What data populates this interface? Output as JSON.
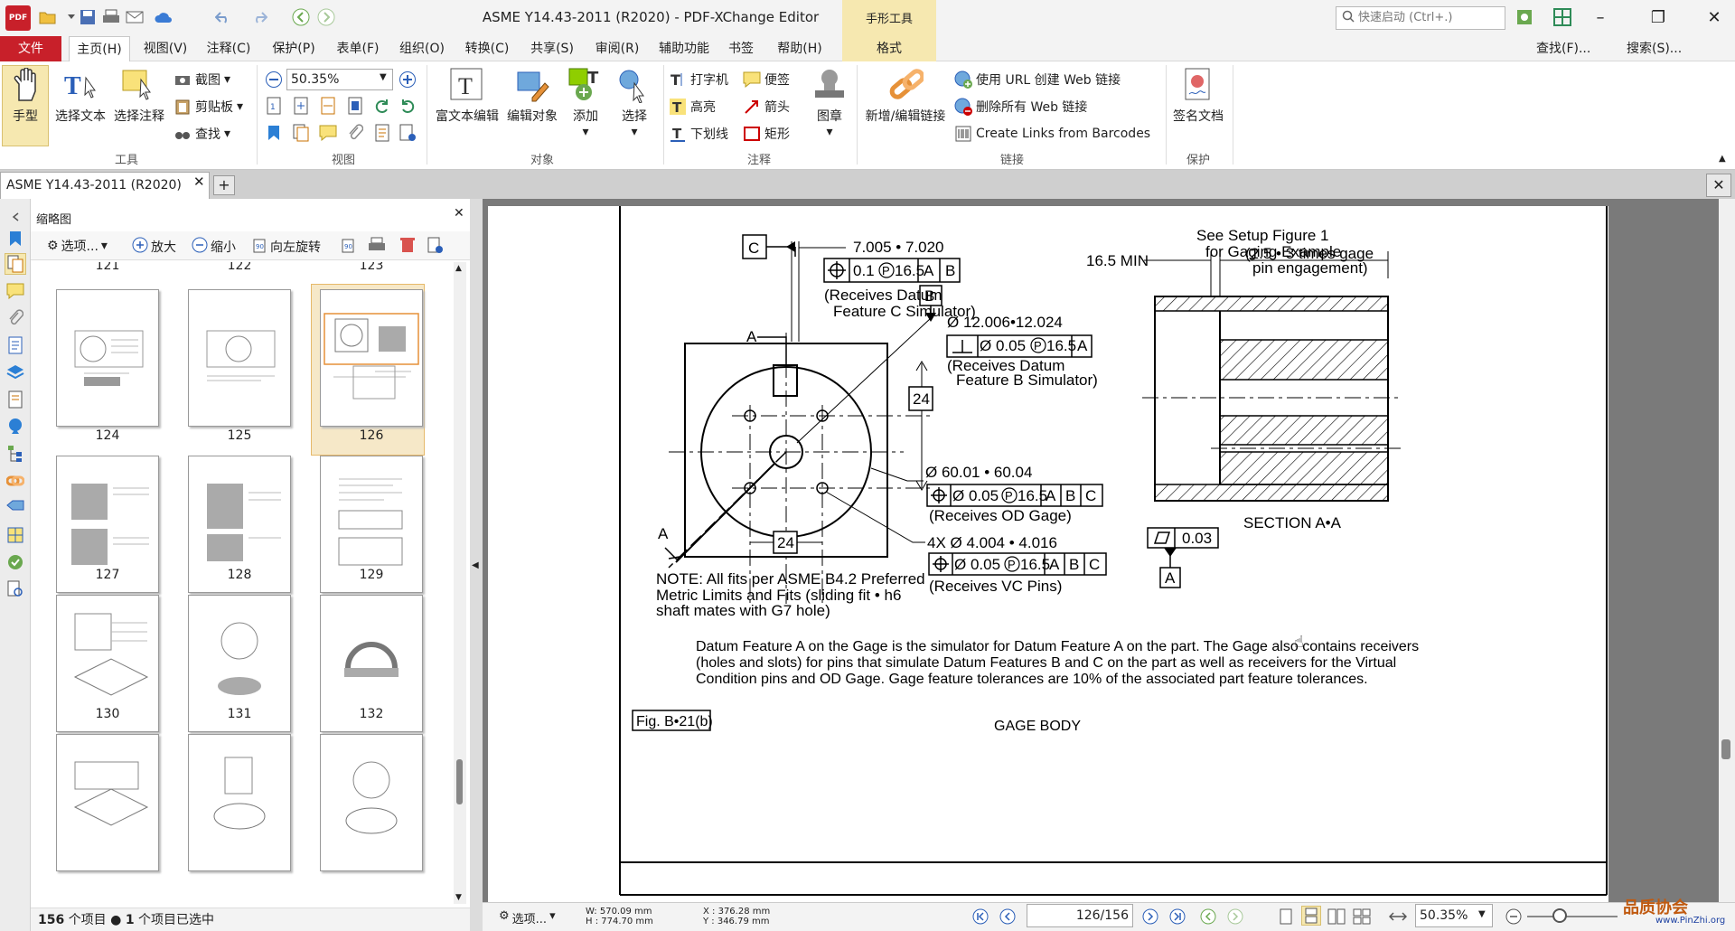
{
  "window": {
    "title": "ASME Y14.43-2011 (R2020) - PDF-XChange Editor",
    "context_tab_group": "手形工具",
    "quick_launch_placeholder": "快速启动 (Ctrl+.)",
    "app_icon_text": "PDF"
  },
  "menu": {
    "file": "文件",
    "items": [
      "主页(H)",
      "视图(V)",
      "注释(C)",
      "保护(P)",
      "表单(F)",
      "组织(O)",
      "转换(C)",
      "共享(S)",
      "审阅(R)",
      "辅助功能",
      "书签",
      "帮助(H)"
    ],
    "context_format": "格式",
    "find": "查找(F)...",
    "search": "搜索(S)..."
  },
  "ribbon": {
    "tools": {
      "hand": "手型",
      "select_text": "选择文本",
      "select_annot": "选择注释",
      "snapshot": "截图",
      "clipboard": "剪贴板",
      "find": "查找",
      "label": "工具"
    },
    "view": {
      "zoom": "50.35%",
      "label": "视图"
    },
    "objects": {
      "rich_text": "富文本编辑",
      "edit_object": "编辑对象",
      "add": "添加",
      "select": "选择",
      "label": "对象"
    },
    "comments": {
      "typewriter": "打字机",
      "note": "便签",
      "highlight": "高亮",
      "arrow": "箭头",
      "underline": "下划线",
      "rectangle": "矩形",
      "stamp": "图章",
      "label": "注释"
    },
    "links": {
      "new_edit": "新增/编辑链接",
      "create_web": "使用 URL 创建 Web 链接",
      "remove_web": "删除所有 Web 链接",
      "from_barcodes": "Create Links from Barcodes",
      "label": "链接"
    },
    "protect": {
      "sign": "签名文档",
      "label": "保护"
    }
  },
  "doc_tab": {
    "title": "ASME Y14.43-2011 (R2020)"
  },
  "thumbnails": {
    "title": "缩略图",
    "toolbar": {
      "options": "选项...",
      "zoom_in": "放大",
      "zoom_out": "缩小",
      "rotate_left": "向左旋转"
    },
    "top_labels": [
      "121",
      "122",
      "123"
    ],
    "rows": [
      [
        "124",
        "125",
        "126"
      ],
      [
        "127",
        "128",
        "129"
      ],
      [
        "130",
        "131",
        "132"
      ],
      [
        "",
        "",
        ""
      ]
    ],
    "selected": "126",
    "status_count": "156",
    "status_count_label": "个项目",
    "status_sel": "1",
    "status_sel_label": "个项目已选中"
  },
  "drawing": {
    "setup_ref": [
      "See Setup Figure 1",
      "for Gaging Example"
    ],
    "datum_c": "C",
    "dim_c": "7.005 • 7.020",
    "fcf1_tol": "0.1",
    "fcf1_mod": "P",
    "fcf1_val": "16.5",
    "fcf1_datums": [
      "A",
      "B"
    ],
    "receives_c": [
      "(Receives Datum",
      "Feature C Simulator)"
    ],
    "datum_b": "B",
    "dia_b": "Ø 12.006•12.024",
    "fcf2_tol": "Ø 0.05",
    "fcf2_val": "16.5",
    "fcf2_datums": [
      "A"
    ],
    "receives_b": [
      "(Receives Datum",
      "Feature B Simulator)"
    ],
    "label_a_top": "A",
    "label_a_bottom": "A",
    "dim_24_right": "24",
    "dim_24_bottom": "24",
    "dia_od": "Ø 60.01 • 60.04",
    "fcf3_tol": "Ø 0.05",
    "fcf3_val": "16.5",
    "fcf3_datums": [
      "A",
      "B",
      "C"
    ],
    "receives_od": "(Receives OD Gage)",
    "dia_vc": "4X Ø 4.004 • 4.016",
    "fcf4_tol": "Ø 0.05",
    "fcf4_val": "16.5",
    "fcf4_datums": [
      "A",
      "B",
      "C"
    ],
    "receives_vc": "(Receives VC Pins)",
    "min_dim": "16.5 MIN",
    "engagement": [
      "(2.5 • 3 times gage",
      "pin engagement)"
    ],
    "section": "SECTION A•A",
    "flatness_val": "0.03",
    "flatness_datum": "A",
    "note": [
      "NOTE: All fits per ASME B4.2 Preferred",
      "Metric Limits and Fits (sliding fit • h6",
      "shaft mates with G7 hole)"
    ],
    "description": [
      "Datum Feature A on the Gage is the simulator for Datum Feature A on the part. The Gage also contains receivers",
      "(holes and slots) for pins that simulate Datum Features B and C on the part as well as receivers for the Virtual",
      "Condition pins and OD Gage. Gage feature tolerances are 10% of the associated part feature tolerances."
    ],
    "fig_label": "Fig. B•21(b)",
    "caption": "GAGE BODY"
  },
  "statusbar": {
    "options": "选项...",
    "width": "W: 570.09 mm",
    "height": "H : 774.70 mm",
    "x": "X : 376.28 mm",
    "y": "Y : 346.79 mm",
    "page_current": "126",
    "page_total": "/156",
    "zoom": "50.35%"
  },
  "watermark": {
    "text": "品质协会",
    "url": "www.PinZhi.org"
  }
}
